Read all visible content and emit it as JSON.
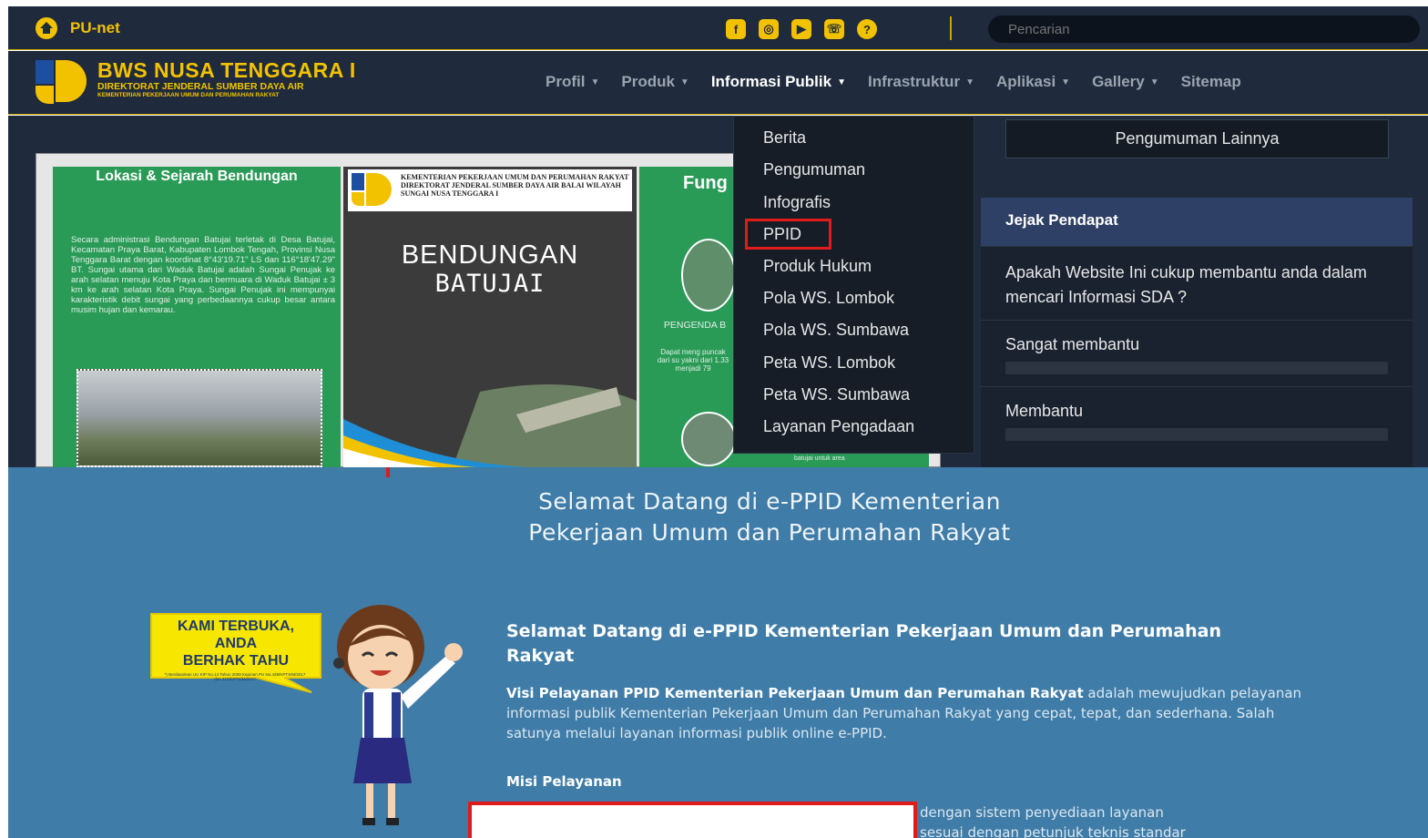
{
  "topbar": {
    "brand": "PU-net",
    "social_icons": [
      "facebook-icon",
      "instagram-icon",
      "youtube-icon",
      "phone-icon",
      "help-icon"
    ],
    "search_placeholder": "Pencarian"
  },
  "header": {
    "logo_title": "BWS NUSA TENGGARA I",
    "logo_subtitle": "DIREKTORAT JENDERAL SUMBER DAYA AIR",
    "logo_ministry": "KEMENTERIAN PEKERJAAN UMUM DAN PERUMAHAN RAKYAT",
    "menu": [
      {
        "label": "Profil",
        "active": false
      },
      {
        "label": "Produk",
        "active": false
      },
      {
        "label": "Informasi Publik",
        "active": true
      },
      {
        "label": "Infrastruktur",
        "active": false
      },
      {
        "label": "Aplikasi",
        "active": false
      },
      {
        "label": "Gallery",
        "active": false
      },
      {
        "label": "Sitemap",
        "active": false
      }
    ]
  },
  "dropdown": {
    "items": [
      "Berita",
      "Pengumuman",
      "Infografis",
      "PPID",
      "Produk Hukum",
      "Pola WS. Lombok",
      "Pola WS. Sumbawa",
      "Peta WS. Lombok",
      "Peta WS. Sumbawa",
      "Layanan Pengadaan"
    ],
    "highlighted": "PPID"
  },
  "poster": {
    "left_title": "Lokasi & Sejarah Bendungan",
    "left_text": "Secara administrasi Bendungan Batujai terletak di Desa Batujai, Kecamatan Praya Barat, Kabupaten Lombok Tengah, Provinsi Nusa Tenggara Barat dengan koordinat 8°43'19.71\" LS dan 116°18'47.29\" BT. Sungai utama dari Waduk Batujai adalah Sungai Penujak ke arah selatan menuju Kota Praya dan bermuara di Waduk Batujai ± 3 km ke arah selatan Kota Praya. Sungai Penujak ini mempunyai karakteristik debit sungai yang perbedaannya cukup besar antara musim hujan dan kemarau.",
    "header_text": "KEMENTERIAN PEKERJAAN UMUM DAN PERUMAHAN RAKYAT DIREKTORAT JENDERAL SUMBER DAYA AIR BALAI WILAYAH SUNGAI NUSA TENGGARA I",
    "center_title_1": "BENDUNGAN",
    "center_title_2": "BATUJAI",
    "right_title": "Fung",
    "right_text": "PENGENDA B",
    "right_text2": "Dapat meng puncak dari su yakni dari 1.33 menjadi 79",
    "right_small": "batujai untuk area"
  },
  "sidebar": {
    "pengumuman_button": "Pengumuman Lainnya",
    "poll_title": "Jejak Pendapat",
    "poll_question": "Apakah Website Ini cukup membantu anda dalam mencari Informasi SDA ?",
    "options": [
      {
        "label": "Sangat membantu",
        "fill": 0.0
      },
      {
        "label": "Membantu",
        "fill": 0.0
      }
    ]
  },
  "ppid": {
    "title_line1": "Selamat Datang di e-PPID Kementerian",
    "title_line2": "Pekerjaan Umum dan Perumahan Rakyat",
    "badge_line1": "KAMI TERBUKA,",
    "badge_line2": "ANDA",
    "badge_line3": "BERHAK TAHU",
    "badge_small": "*) Berdasarkan UU KIP No.14 Tahun 2008 Kepmen PU No.439/KPTS/M/2017 dan 410/KPTS/M/2017",
    "content_heading": "Selamat Datang di e-PPID Kementerian Pekerjaan Umum dan Perumahan Rakyat",
    "visi_bold": "Visi Pelayanan PPID Kementerian Pekerjaan Umum dan Perumahan Rakyat",
    "visi_text": " adalah mewujudkan pelayanan informasi publik Kementerian Pekerjaan Umum dan Perumahan Rakyat yang cepat, tepat, dan sederhana. Salah satunya melalui layanan informasi publik online e-PPID.",
    "misi_heading": "Misi Pelayanan",
    "misi_line1": "dengan sistem penyediaan layanan",
    "misi_line2": "sesuai dengan petunjuk teknis standar"
  },
  "colors": {
    "navy": "#1f2b3d",
    "gold": "#f2c200",
    "ppid_blue": "#3f7ca7",
    "highlight_red": "#e01b1b"
  }
}
